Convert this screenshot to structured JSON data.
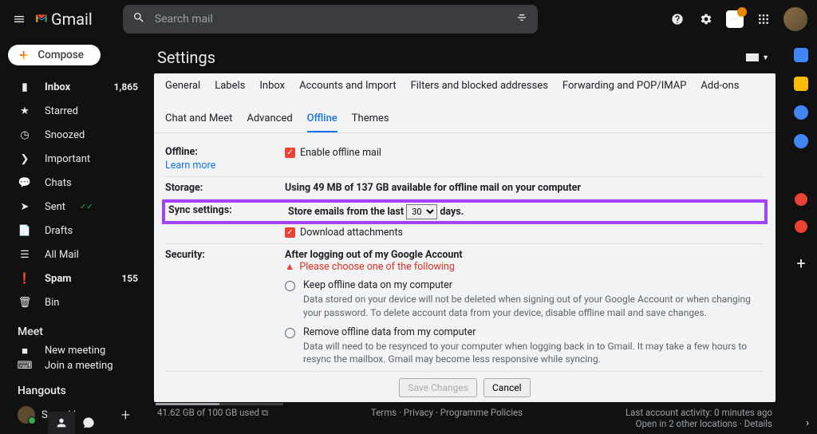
{
  "header": {
    "product": "Gmail",
    "search_placeholder": "Search mail"
  },
  "compose_label": "Compose",
  "nav": [
    {
      "icon": "inbox",
      "label": "Inbox",
      "count": "1,865",
      "bold": true
    },
    {
      "icon": "star",
      "label": "Starred"
    },
    {
      "icon": "clock",
      "label": "Snoozed"
    },
    {
      "icon": "arrow",
      "label": "Important"
    },
    {
      "icon": "chat",
      "label": "Chats"
    },
    {
      "icon": "sent",
      "label": "Sent",
      "checks": true
    },
    {
      "icon": "file",
      "label": "Drafts"
    },
    {
      "icon": "stack",
      "label": "All Mail"
    },
    {
      "icon": "spam",
      "label": "Spam",
      "count": "155",
      "bold": true
    },
    {
      "icon": "trash",
      "label": "Bin"
    }
  ],
  "meet": {
    "title": "Meet",
    "items": [
      "New meeting",
      "Join a meeting"
    ]
  },
  "hangouts": {
    "title": "Hangouts",
    "user": "Sumukh"
  },
  "settings_title": "Settings",
  "tabs": [
    "General",
    "Labels",
    "Inbox",
    "Accounts and Import",
    "Filters and blocked addresses",
    "Forwarding and POP/IMAP",
    "Add-ons",
    "Chat and Meet",
    "Advanced",
    "Offline",
    "Themes"
  ],
  "active_tab": "Offline",
  "offline": {
    "label": "Offline:",
    "learn": "Learn more",
    "enable": "Enable offline mail"
  },
  "storage": {
    "label": "Storage:",
    "text": "Using 49 MB of 137 GB available for offline mail on your computer"
  },
  "sync": {
    "label": "Sync settings:",
    "prefix": "Store emails from the last",
    "value": "30",
    "suffix": "days.",
    "download": "Download attachments"
  },
  "security": {
    "label": "Security:",
    "heading": "After logging out of my Google Account",
    "warning": "Please choose one of the following",
    "opt1": {
      "title": "Keep offline data on my computer",
      "sub": "Data stored on your device will not be deleted when signing out of your Google Account or when changing your password. To delete account data from your device, disable offline mail and save changes."
    },
    "opt2": {
      "title": "Remove offline data from my computer",
      "sub": "Data will need to be resynced to your computer when logging back in to Gmail. It may take a few hours to resync the mailbox. Gmail may become less responsive while syncing."
    }
  },
  "buttons": {
    "save": "Save Changes",
    "cancel": "Cancel"
  },
  "footer": {
    "storage": "41.62 GB of 100 GB used",
    "center": "Terms · Privacy · Programme Policies",
    "right1": "Last account activity: 0 minutes ago",
    "right2": "Open in 2 other locations · Details"
  }
}
